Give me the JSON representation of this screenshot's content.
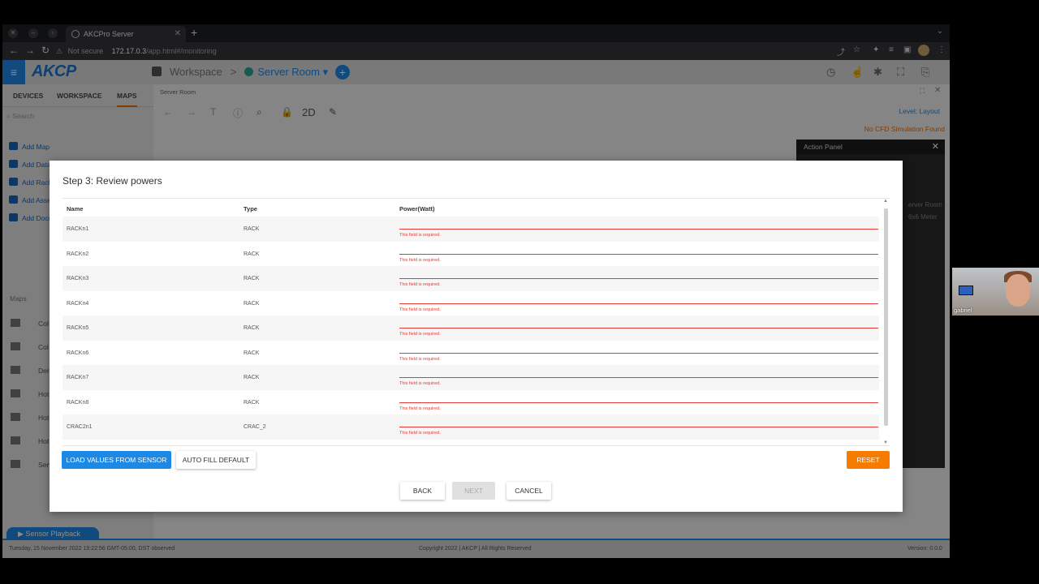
{
  "browser": {
    "tab_title": "AKCPro Server",
    "url_warning": "Not secure",
    "url_host": "172.17.0.3",
    "url_path": "/app.html#/monitoring"
  },
  "header": {
    "logo": "AKCP",
    "breadcrumb_workspace": "Workspace",
    "breadcrumb_sep": ">",
    "breadcrumb_room": "Server Room",
    "room_caret": "▾"
  },
  "sidebar": {
    "tabs": [
      "DEVICES",
      "WORKSPACE",
      "MAPS"
    ],
    "search_placeholder": "Search",
    "actions": [
      "Add Map",
      "Add Data Center",
      "Add Rack",
      "Add Asset",
      "Add Document"
    ],
    "maps_label": "Maps",
    "maps": [
      "Col",
      "Col",
      "Den",
      "Hot",
      "Hot",
      "Hot",
      "Serv"
    ]
  },
  "content": {
    "breadcrumb": "Server Room",
    "view_mode": "2D",
    "level": "Level: Layout",
    "cfd_status": "No CFD Simulation Found",
    "action_panel_title": "Action Panel",
    "room_name": "erver Room",
    "room_dims": "6x6 Meter"
  },
  "statusbar": {
    "datetime": "Tuesday, 15 November 2022 19:22:56 GMT-05:00, DST observed",
    "copyright": "Copyright 2022 | AKCP | All Rights Reserved",
    "version": "Version: 0.0.0",
    "playback": "Sensor Playback"
  },
  "dialog": {
    "title": "Step 3: Review powers",
    "columns": {
      "name": "Name",
      "type": "Type",
      "power": "Power(Watt)"
    },
    "rows": [
      {
        "name": "RACKn1",
        "type": "RACK",
        "power": "",
        "error": "This field is required."
      },
      {
        "name": "RACKn2",
        "type": "RACK",
        "power": "",
        "error": "This field is required."
      },
      {
        "name": "RACKn3",
        "type": "RACK",
        "power": "",
        "error": "This field is required."
      },
      {
        "name": "RACKn4",
        "type": "RACK",
        "power": "",
        "error": "This field is required."
      },
      {
        "name": "RACKn5",
        "type": "RACK",
        "power": "",
        "error": "This field is required."
      },
      {
        "name": "RACKn6",
        "type": "RACK",
        "power": "",
        "error": "This field is required."
      },
      {
        "name": "RACKn7",
        "type": "RACK",
        "power": "",
        "error": "This field is required."
      },
      {
        "name": "RACKn8",
        "type": "RACK",
        "power": "",
        "error": "This field is required."
      },
      {
        "name": "CRAC2n1",
        "type": "CRAC_2",
        "power": "",
        "error": "This field is required."
      }
    ],
    "buttons": {
      "load": "LOAD VALUES FROM SENSOR",
      "autofill": "AUTO FILL DEFAULT",
      "reset": "RESET",
      "back": "BACK",
      "next": "NEXT",
      "cancel": "CANCEL"
    }
  },
  "webcam": {
    "name": "gabriel"
  },
  "colors": {
    "accent": "#1e88e5",
    "reset": "#f57c00",
    "error": "#e53935"
  },
  "icons": [
    "close-icon",
    "minimize-icon",
    "restore-icon",
    "favicon-icon",
    "plus-icon",
    "back-arrow-icon",
    "forward-arrow-icon",
    "reload-icon",
    "warning-icon",
    "share-icon",
    "star-icon",
    "extension-icon",
    "menu-icon",
    "search-icon",
    "lock-icon",
    "pencil-icon",
    "clock-icon",
    "expand-icon",
    "play-icon"
  ]
}
